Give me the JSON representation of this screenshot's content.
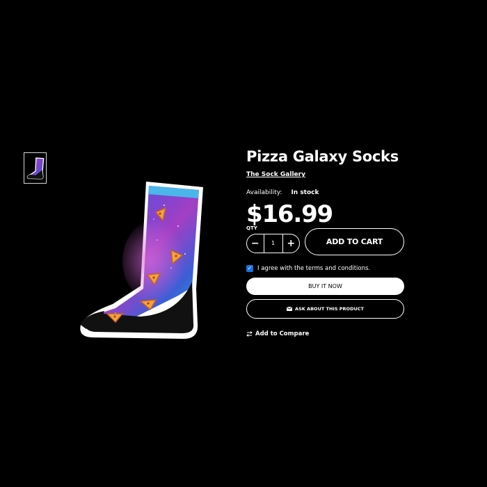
{
  "product": {
    "title": "Pizza Galaxy Socks",
    "vendor": "The Sock Gallery",
    "availability_label": "Availability:",
    "availability_value": "In stock",
    "price": "$16.99"
  },
  "gallery": {
    "thumbnail_icon": "sock-thumbnail-icon",
    "main_image_icon": "pizza-galaxy-sock-image"
  },
  "purchase": {
    "qty_label": "QTY",
    "qty_value": "1",
    "minus_icon": "minus-icon",
    "plus_icon": "plus-icon",
    "add_to_cart": "ADD TO CART",
    "terms_text": "I agree with the terms and conditions.",
    "terms_checked": true,
    "buy_now": "BUY IT NOW",
    "ask_label": "ASK ABOUT THIS PRODUCT",
    "ask_icon": "envelope-icon",
    "compare_label": "Add to Compare",
    "compare_icon": "compare-arrows-icon"
  },
  "colors": {
    "background": "#000000",
    "text": "#ffffff",
    "checkbox": "#1a73e8"
  }
}
